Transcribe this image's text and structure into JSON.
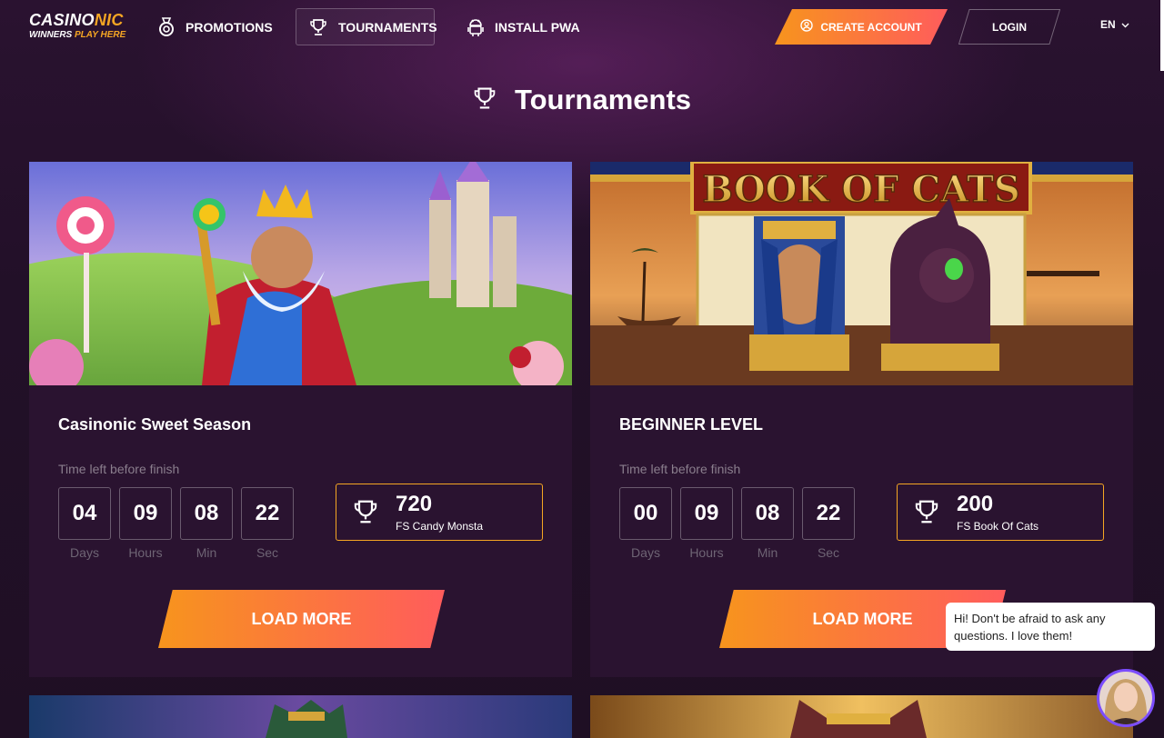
{
  "header": {
    "logo": {
      "main_prefix": "CASINO",
      "main_accent": "NIC",
      "sub_prefix": "WINNERS ",
      "sub_accent": "PLAY HERE"
    },
    "nav": [
      {
        "label": "PROMOTIONS",
        "icon": "badge-icon"
      },
      {
        "label": "TOURNAMENTS",
        "icon": "trophy-icon",
        "active": true
      },
      {
        "label": "INSTALL PWA",
        "icon": "android-icon"
      }
    ],
    "create_account": "CREATE ACCOUNT",
    "login": "LOGIN",
    "language": "EN"
  },
  "page": {
    "title": "Tournaments"
  },
  "tournaments": [
    {
      "title": "Casinonic Sweet Season",
      "time_label": "Time left before finish",
      "countdown": [
        {
          "value": "04",
          "unit": "Days"
        },
        {
          "value": "09",
          "unit": "Hours"
        },
        {
          "value": "08",
          "unit": "Min"
        },
        {
          "value": "22",
          "unit": "Sec"
        }
      ],
      "prize": {
        "value": "720",
        "description": "FS Candy Monsta"
      },
      "button": "LOAD MORE"
    },
    {
      "title": "BEGINNER LEVEL",
      "banner_text": "BOOK OF CATS",
      "time_label": "Time left before finish",
      "countdown": [
        {
          "value": "00",
          "unit": "Days"
        },
        {
          "value": "09",
          "unit": "Hours"
        },
        {
          "value": "08",
          "unit": "Min"
        },
        {
          "value": "22",
          "unit": "Sec"
        }
      ],
      "prize": {
        "value": "200",
        "description": "FS Book Of Cats"
      },
      "button": "LOAD MORE"
    }
  ],
  "chat": {
    "message": "Hi! Don't be afraid to ask any questions. I love them!"
  },
  "colors": {
    "accent_start": "#f7941d",
    "accent_end": "#ff5c5c",
    "gold": "#f5a623",
    "background": "#221028",
    "card": "#2a1330"
  }
}
